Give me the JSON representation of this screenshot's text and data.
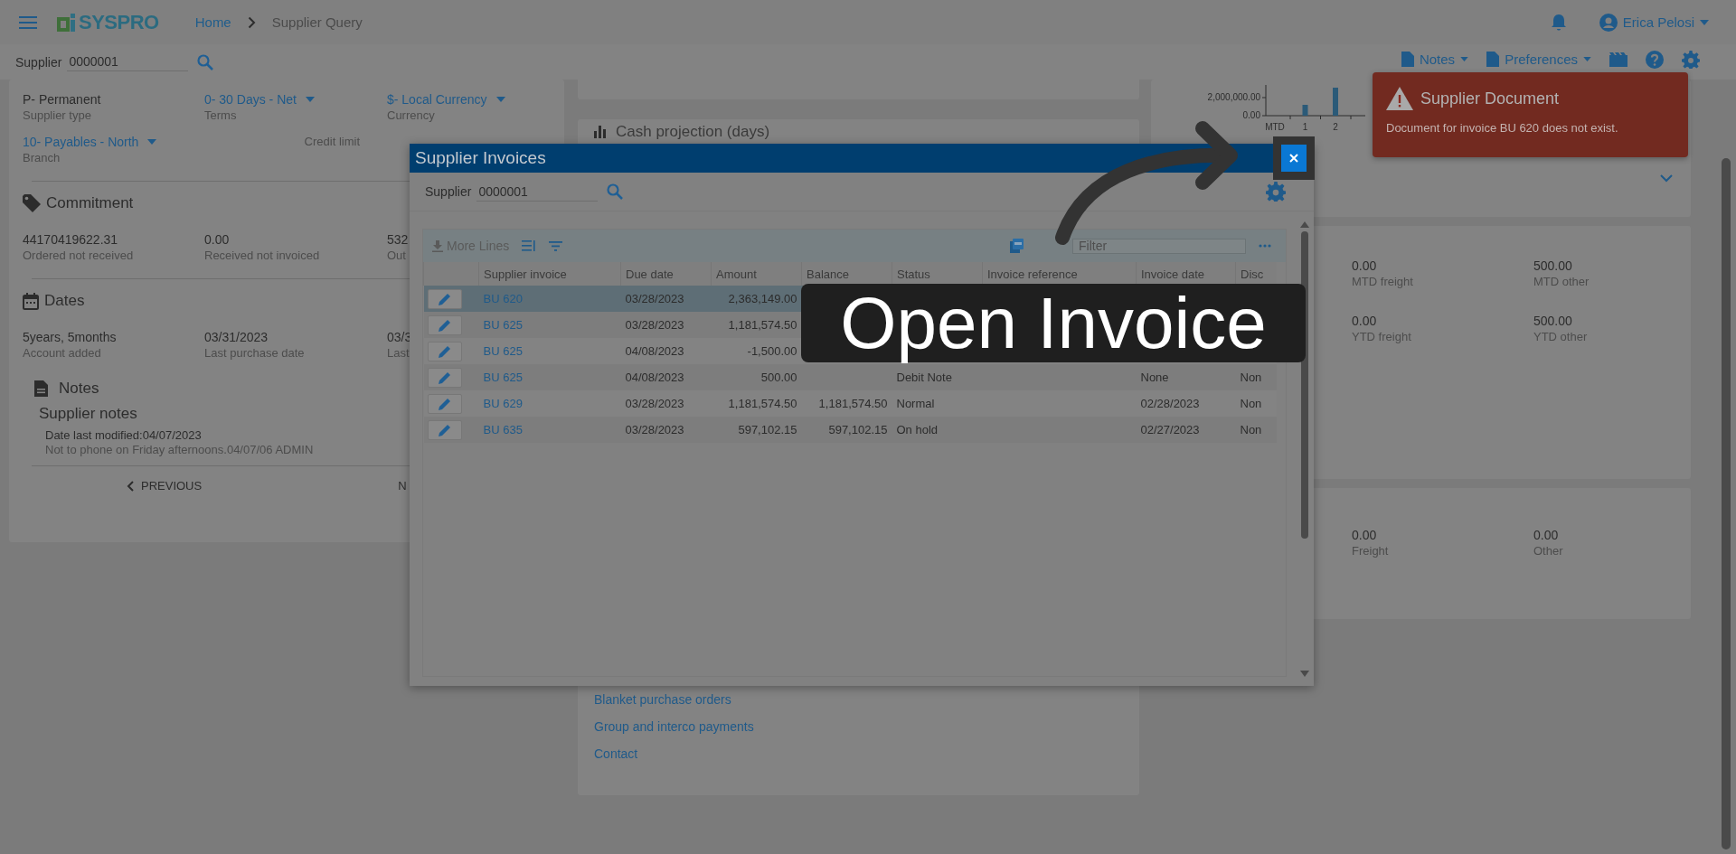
{
  "header": {
    "logo": "SYSPRO",
    "breadcrumb": [
      {
        "label": "Home",
        "kind": "link"
      },
      {
        "label": "Supplier Query",
        "kind": "current"
      }
    ],
    "user": "Erica Pelosi"
  },
  "supplier_bar": {
    "label": "Supplier",
    "value": "0000001"
  },
  "toolbar": [
    "Notes",
    "Preferences"
  ],
  "summary_card": {
    "fields": [
      {
        "value": "P- Permanent",
        "label": "Supplier type",
        "kind": "text"
      },
      {
        "value": "0- 30 Days - Net",
        "label": "Terms",
        "kind": "dropdown"
      },
      {
        "value": "$- Local Currency",
        "label": "Currency",
        "kind": "dropdown"
      },
      {
        "value": "10- Payables - North",
        "label": "Branch",
        "kind": "dropdown"
      },
      {
        "label": "Credit limit"
      }
    ],
    "commitment": {
      "title": "Commitment",
      "fields": [
        {
          "value": "44170419622.31",
          "label": "Ordered not received"
        },
        {
          "value": "0.00",
          "label": "Received not invoiced"
        },
        {
          "value": "532",
          "label": "Out"
        }
      ]
    },
    "dates": {
      "title": "Dates",
      "fields": [
        {
          "value": "5years, 5months",
          "label": "Account added"
        },
        {
          "value": "03/31/2023",
          "label": "Last purchase date"
        },
        {
          "value": "03/3",
          "label": "Last"
        }
      ]
    },
    "notes": {
      "title": "Notes",
      "subtitle": "Supplier notes",
      "modified": "Date last modified:04/07/2023",
      "text": "Not to phone on Friday afternoons.04/07/06 ADMIN"
    },
    "pager": {
      "previous": "PREVIOUS",
      "next": "N"
    }
  },
  "middle": {
    "section_title": "Cash projection (days)",
    "links": [
      "Blanket purchase orders",
      "Group and interco payments",
      "Contact"
    ]
  },
  "right": {
    "chart_data": {
      "type": "bar",
      "categories": [
        "MTD",
        "1",
        "2"
      ],
      "values": [
        null,
        1200000,
        3100000
      ],
      "ylim": [
        0,
        3200000
      ],
      "yticks": [
        {
          "value": 0,
          "label": "0.00"
        },
        {
          "value": 2000000,
          "label": "2,000,000.00"
        }
      ]
    },
    "metrics": [
      {
        "value": "0.00",
        "label": "MTD freight"
      },
      {
        "value": "500.00",
        "label": "MTD other"
      },
      {
        "value": "0.00",
        "label": "YTD freight"
      },
      {
        "value": "500.00",
        "label": "YTD other"
      }
    ],
    "totals": [
      {
        "value": "0.00",
        "label": "Freight"
      },
      {
        "value": "0.00",
        "label": "Other"
      }
    ]
  },
  "dialog": {
    "title": "Supplier Invoices",
    "supplier_label": "Supplier",
    "supplier_value": "0000001",
    "more_lines": "More Lines",
    "filter_placeholder": "Filter",
    "columns": [
      "Supplier invoice",
      "Due date",
      "Amount",
      "Balance",
      "Status",
      "Invoice reference",
      "Invoice date",
      "Disc"
    ],
    "rows": [
      {
        "selected": true,
        "invoice": "BU 620",
        "due_date": "03/28/2023",
        "amount": "2,363,149.00"
      },
      {
        "selected": false,
        "invoice": "BU 625",
        "due_date": "03/28/2023",
        "amount": "1,181,574.50"
      },
      {
        "selected": false,
        "invoice": "BU 625",
        "due_date": "04/08/2023",
        "amount": "-1,500.00"
      },
      {
        "selected": false,
        "invoice": "BU 625",
        "due_date": "04/08/2023",
        "amount": "500.00",
        "status": "Debit Note",
        "invoice_date": "None",
        "disc": "Non"
      },
      {
        "selected": false,
        "invoice": "BU 629",
        "due_date": "03/28/2023",
        "amount": "1,181,574.50",
        "balance": "1,181,574.50",
        "status": "Normal",
        "invoice_date": "02/28/2023",
        "disc": "Non"
      },
      {
        "selected": false,
        "invoice": "BU 635",
        "due_date": "03/28/2023",
        "amount": "597,102.15",
        "balance": "597,102.15",
        "status": "On hold",
        "invoice_date": "02/27/2023",
        "disc": "Non"
      }
    ]
  },
  "toast": {
    "title": "Supplier Document",
    "message": "Document for invoice BU 620 does not exist."
  },
  "tooltip": "Open Invoice"
}
